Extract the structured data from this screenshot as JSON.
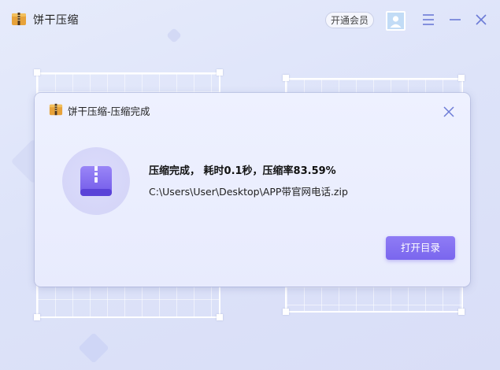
{
  "app": {
    "title": "饼干压缩",
    "vip_label": "开通会员",
    "icons": {
      "logo": "zip-archive-logo-icon",
      "avatar": "user-avatar-icon",
      "menu": "menu-icon",
      "minimize": "minimize-icon",
      "close": "close-icon"
    }
  },
  "dialog": {
    "title": "饼干压缩-压缩完成",
    "result_text": "压缩完成， 耗时0.1秒，压缩率83.59%",
    "file_path": "C:\\Users\\User\\Desktop\\APP带官网电话.zip",
    "open_folder_label": "打开目录",
    "icons": {
      "archive": "archive-box-icon",
      "close": "close-icon"
    }
  },
  "colors": {
    "accent": "#7c69ef",
    "background": "#dde3f9",
    "icon_stroke": "#6c7bd6"
  }
}
